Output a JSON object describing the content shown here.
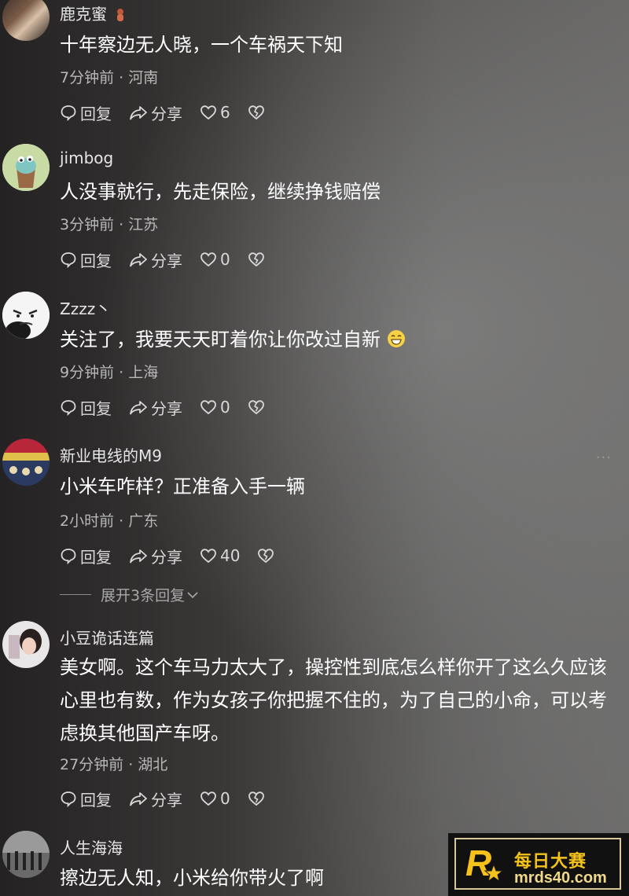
{
  "comments": [
    {
      "username": "鹿克蜜",
      "badge_icon": "bear-emoji-icon",
      "text": "十年察边无人晓，一个车祸天下知",
      "meta": "7分钟前 · 河南",
      "reply_label": "回复",
      "share_label": "分享",
      "likes": "6"
    },
    {
      "username": "jimbog",
      "text": "人没事就行，先走保险，继续挣钱赔偿",
      "meta": "3分钟前 · 江苏",
      "reply_label": "回复",
      "share_label": "分享",
      "likes": "0"
    },
    {
      "username": "Zzzz丶",
      "text": "关注了，我要天天盯着你让你改过自新",
      "text_emoji": "grinning-emoji-icon",
      "meta": "9分钟前 · 上海",
      "reply_label": "回复",
      "share_label": "分享",
      "likes": "0"
    },
    {
      "username": "新业电线的M9",
      "text": "小米车咋样？正准备入手一辆",
      "meta": "2小时前 · 广东",
      "reply_label": "回复",
      "share_label": "分享",
      "likes": "40",
      "more": "···",
      "expand_label": "展开3条回复"
    },
    {
      "username": "小豆诡话连篇",
      "text": "美女啊。这个车马力太大了，操控性到底怎么样你开了这么久应该心里也有数，作为女孩子你把握不住的，为了自己的小命，可以考虑换其他国产车呀。",
      "meta": "27分钟前 · 湖北",
      "reply_label": "回复",
      "share_label": "分享",
      "likes": "0"
    },
    {
      "username": "人生海海",
      "text": "擦边无人知，小米给你带火了啊"
    }
  ],
  "watermark": {
    "logo_letter": "R",
    "line1": "每日大赛",
    "line2": "mrds40.com"
  },
  "colors": {
    "accent": "#f4c21a",
    "text": "#ffffff",
    "meta": "#b8b8b8"
  }
}
